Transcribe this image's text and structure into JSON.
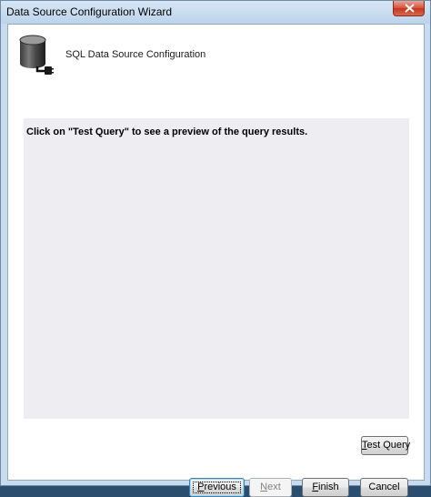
{
  "window": {
    "title": "Data Source Configuration Wizard"
  },
  "header": {
    "title": "SQL Data Source Configuration",
    "icon": "database-plug-icon"
  },
  "preview": {
    "instruction": "Click on \"Test Query\" to see a preview of the query results."
  },
  "buttons": {
    "test_query": {
      "access_key": "T",
      "rest": "est Query"
    },
    "previous": {
      "access_key": "P",
      "rest": "revious"
    },
    "next": {
      "access_key": "N",
      "rest": "ext",
      "disabled": true
    },
    "finish": {
      "access_key": "F",
      "rest": "inish"
    },
    "cancel": {
      "label": "Cancel"
    }
  },
  "colors": {
    "title_bar": "#c9dcef",
    "close_button": "#d5513a",
    "preview_background": "#eeeef2"
  }
}
